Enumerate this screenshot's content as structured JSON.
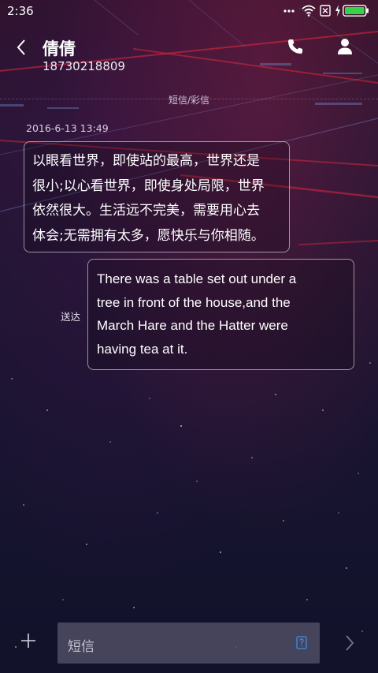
{
  "status_bar": {
    "time": "2:36",
    "icons": [
      "dots-icon",
      "wifi-icon",
      "sim-off-icon",
      "charging-icon",
      "battery-icon"
    ],
    "battery_color": "#35d24a"
  },
  "header": {
    "contact_name": "倩倩",
    "phone_number": "18730218809"
  },
  "conversation": {
    "channel_label": "短信/彩信",
    "timestamp": "2016-6-13 13:49",
    "messages": [
      {
        "direction": "incoming",
        "lines": [
          "以眼看世界，即使站的最高，世界还是",
          "很小;以心看世界，即使身处局限，世界",
          "依然很大。生活远不完美，需要用心去",
          "体会;无需拥有太多，愿快乐与你相随。"
        ]
      },
      {
        "direction": "outgoing",
        "status": "送达",
        "lines": [
          "There was a table set out under a",
          "tree in front of the house,and the",
          "March Hare and the Hatter were",
          "having tea at it."
        ]
      }
    ]
  },
  "composer": {
    "placeholder": "短信"
  }
}
